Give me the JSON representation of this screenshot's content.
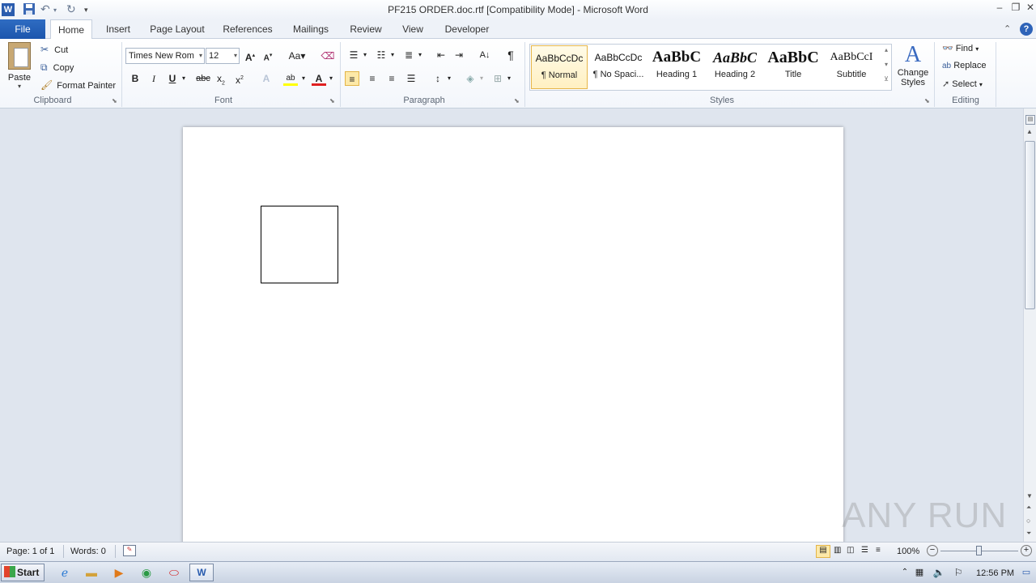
{
  "window": {
    "title": "PF215 ORDER.doc.rtf [Compatibility Mode]  -  Microsoft Word"
  },
  "tabs": [
    {
      "label": "File"
    },
    {
      "label": "Home"
    },
    {
      "label": "Insert"
    },
    {
      "label": "Page Layout"
    },
    {
      "label": "References"
    },
    {
      "label": "Mailings"
    },
    {
      "label": "Review"
    },
    {
      "label": "View"
    },
    {
      "label": "Developer"
    }
  ],
  "clipboard": {
    "paste": "Paste",
    "cut": "Cut",
    "copy": "Copy",
    "format_painter": "Format Painter",
    "group": "Clipboard"
  },
  "font": {
    "name": "Times New Rom",
    "size": "12",
    "group": "Font"
  },
  "paragraph": {
    "group": "Paragraph"
  },
  "styles": {
    "group": "Styles",
    "items": [
      {
        "preview": "AaBbCcDc",
        "name": "¶ Normal"
      },
      {
        "preview": "AaBbCcDc",
        "name": "¶ No Spaci..."
      },
      {
        "preview": "AaBbC",
        "name": "Heading 1"
      },
      {
        "preview": "AaBbC",
        "name": "Heading 2"
      },
      {
        "preview": "AaBbC",
        "name": "Title"
      },
      {
        "preview": "AaBbCcI",
        "name": "Subtitle"
      }
    ],
    "change_styles_1": "Change",
    "change_styles_2": "Styles"
  },
  "editing": {
    "find": "Find",
    "replace": "Replace",
    "select": "Select",
    "group": "Editing"
  },
  "status": {
    "page": "Page: 1 of 1",
    "words": "Words: 0",
    "zoom": "100%"
  },
  "taskbar": {
    "start": "Start",
    "clock": "12:56 PM"
  },
  "watermark": "ANY RUN"
}
